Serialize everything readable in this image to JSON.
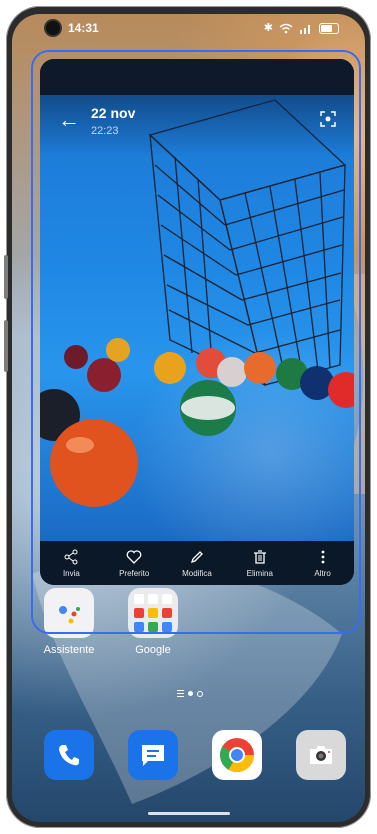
{
  "status_bar": {
    "time": "14:31",
    "icons": [
      "bluetooth-icon",
      "wifi-icon",
      "signal-icon",
      "battery-icon"
    ]
  },
  "gallery_card": {
    "date": "22 nov",
    "time": "22:23",
    "toolbar": [
      {
        "label": "Invia",
        "icon": "share-icon"
      },
      {
        "label": "Preferito",
        "icon": "heart-icon"
      },
      {
        "label": "Modifica",
        "icon": "pencil-icon"
      },
      {
        "label": "Elimina",
        "icon": "trash-icon"
      },
      {
        "label": "Altro",
        "icon": "more-icon"
      }
    ]
  },
  "home": {
    "apps": [
      {
        "label": "Assistente",
        "icon": "assistant-icon"
      },
      {
        "label": "Google",
        "icon": "google-folder-icon"
      }
    ],
    "dock": [
      {
        "icon": "phone-icon",
        "color": "#1a73e8"
      },
      {
        "icon": "messages-icon",
        "color": "#1a73e8"
      },
      {
        "icon": "chrome-icon",
        "color": "#ffffff"
      },
      {
        "icon": "camera-icon",
        "color": "#d9d9d9"
      }
    ]
  },
  "colors": {
    "outline": "#3a6cf0",
    "toolbar_bg": "#0b1828",
    "photo_blue": "#1f88e4"
  }
}
